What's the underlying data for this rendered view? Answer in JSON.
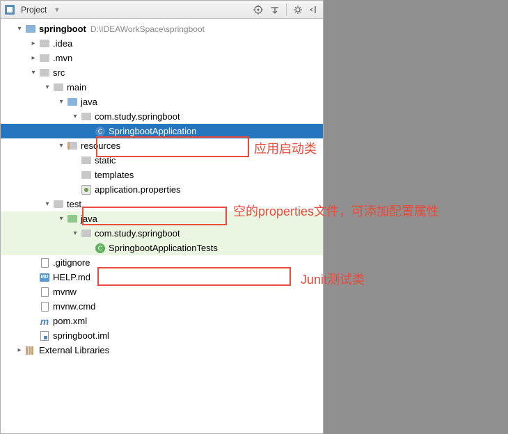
{
  "toolbar": {
    "title": "Project"
  },
  "tree": {
    "root": {
      "name": "springboot",
      "path": "D:\\IDEAWorkSpace\\springboot"
    },
    "idea": ".idea",
    "mvn": ".mvn",
    "src": "src",
    "main": "main",
    "java_main": "java",
    "pkg_main": "com.study.springboot",
    "app_class": "SpringbootApplication",
    "resources": "resources",
    "static": "static",
    "templates": "templates",
    "app_props": "application.properties",
    "test": "test",
    "java_test": "java",
    "pkg_test": "com.study.springboot",
    "test_class": "SpringbootApplicationTests",
    "gitignore": ".gitignore",
    "help": "HELP.md",
    "mvnw": "mvnw",
    "mvnwcmd": "mvnw.cmd",
    "pom": "pom.xml",
    "iml": "springboot.iml",
    "extlib": "External Libraries"
  },
  "annotations": {
    "startup": "应用启动类",
    "props": "空的properties文件，可添加配置属性",
    "junit": "Junit测试类"
  }
}
